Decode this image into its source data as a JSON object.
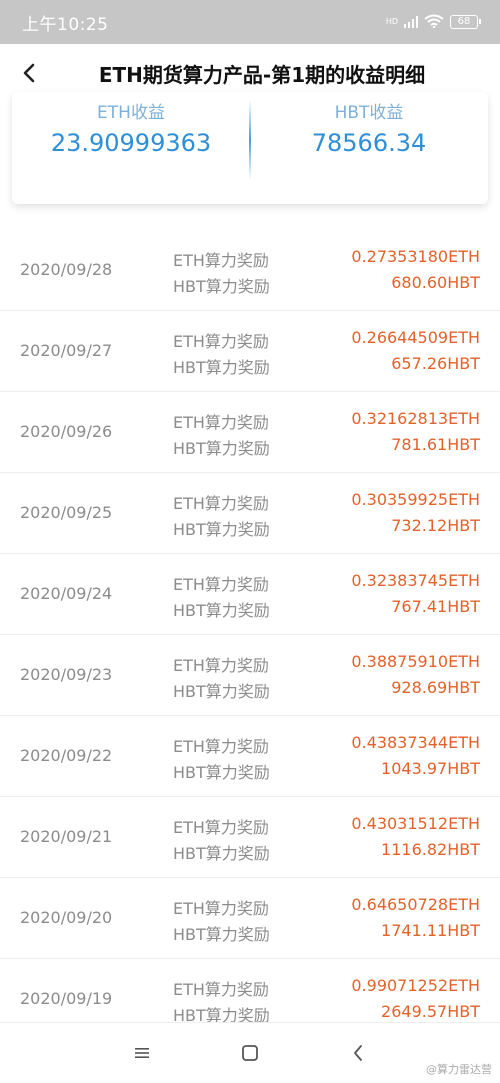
{
  "status_bar": {
    "time": "上午10:25",
    "network": "HD",
    "battery": "68"
  },
  "header": {
    "title": "ETH期货算力产品-第1期的收益明细"
  },
  "summary": {
    "eth_label": "ETH收益",
    "eth_value": "23.90999363",
    "hbt_label": "HBT收益",
    "hbt_value": "78566.34"
  },
  "records": [
    {
      "date": "2020/09/28",
      "label_eth": "ETH算力奖励",
      "label_hbt": "HBT算力奖励",
      "eth": "0.27353180ETH",
      "hbt": "680.60HBT"
    },
    {
      "date": "2020/09/27",
      "label_eth": "ETH算力奖励",
      "label_hbt": "HBT算力奖励",
      "eth": "0.26644509ETH",
      "hbt": "657.26HBT"
    },
    {
      "date": "2020/09/26",
      "label_eth": "ETH算力奖励",
      "label_hbt": "HBT算力奖励",
      "eth": "0.32162813ETH",
      "hbt": "781.61HBT"
    },
    {
      "date": "2020/09/25",
      "label_eth": "ETH算力奖励",
      "label_hbt": "HBT算力奖励",
      "eth": "0.30359925ETH",
      "hbt": "732.12HBT"
    },
    {
      "date": "2020/09/24",
      "label_eth": "ETH算力奖励",
      "label_hbt": "HBT算力奖励",
      "eth": "0.32383745ETH",
      "hbt": "767.41HBT"
    },
    {
      "date": "2020/09/23",
      "label_eth": "ETH算力奖励",
      "label_hbt": "HBT算力奖励",
      "eth": "0.38875910ETH",
      "hbt": "928.69HBT"
    },
    {
      "date": "2020/09/22",
      "label_eth": "ETH算力奖励",
      "label_hbt": "HBT算力奖励",
      "eth": "0.43837344ETH",
      "hbt": "1043.97HBT"
    },
    {
      "date": "2020/09/21",
      "label_eth": "ETH算力奖励",
      "label_hbt": "HBT算力奖励",
      "eth": "0.43031512ETH",
      "hbt": "1116.82HBT"
    },
    {
      "date": "2020/09/20",
      "label_eth": "ETH算力奖励",
      "label_hbt": "HBT算力奖励",
      "eth": "0.64650728ETH",
      "hbt": "1741.11HBT"
    },
    {
      "date": "2020/09/19",
      "label_eth": "ETH算力奖励",
      "label_hbt": "HBT算力奖励",
      "eth": "0.99071252ETH",
      "hbt": "2649.57HBT"
    }
  ],
  "watermark": "@算力雷达营",
  "icons": {
    "back": "chevron-left-icon",
    "menu": "menu-icon",
    "home": "home-square-icon",
    "nav_back": "nav-back-icon"
  },
  "colors": {
    "accent_blue": "#2f8fd6",
    "value_orange": "#e3622a",
    "status_bar_bg": "#c6c6c6"
  }
}
